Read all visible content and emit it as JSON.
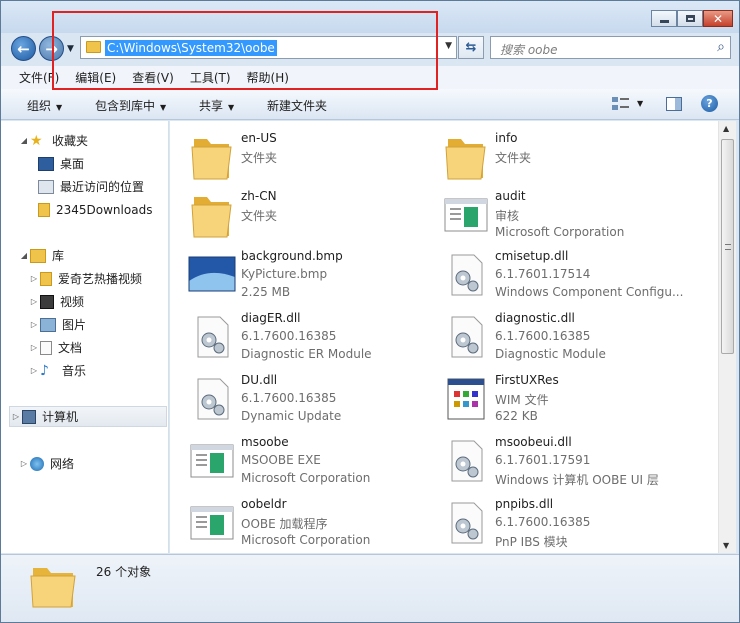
{
  "address": {
    "path": "C:\\Windows\\System32\\oobe"
  },
  "search": {
    "placeholder": "搜索 oobe"
  },
  "menu": [
    "文件(F)",
    "编辑(E)",
    "查看(V)",
    "工具(T)",
    "帮助(H)"
  ],
  "toolbar": {
    "organize": "组织",
    "include": "包含到库中",
    "share": "共享",
    "new_folder": "新建文件夹"
  },
  "nav": {
    "favorites": "收藏夹",
    "desktop": "桌面",
    "recent": "最近访问的位置",
    "downloads": "2345Downloads",
    "libraries": "库",
    "iqiyi": "爱奇艺热播视频",
    "videos": "视频",
    "pictures": "图片",
    "documents": "文档",
    "music": "音乐",
    "computer": "计算机",
    "network": "网络"
  },
  "files": [
    {
      "name": "en-US",
      "l2": "文件夹",
      "l3": "",
      "icon": "folder-icon"
    },
    {
      "name": "info",
      "l2": "文件夹",
      "l3": "",
      "icon": "folder-icon"
    },
    {
      "name": "zh-CN",
      "l2": "文件夹",
      "l3": "",
      "icon": "folder-icon"
    },
    {
      "name": "audit",
      "l2": "审核",
      "l3": "Microsoft Corporation",
      "icon": "exe-icon"
    },
    {
      "name": "background.bmp",
      "l2": "KyPicture.bmp",
      "l3": "2.25 MB",
      "icon": "image-icon"
    },
    {
      "name": "cmisetup.dll",
      "l2": "6.1.7601.17514",
      "l3": "Windows Component Configu...",
      "icon": "dll-icon"
    },
    {
      "name": "diagER.dll",
      "l2": "6.1.7600.16385",
      "l3": "Diagnostic ER Module",
      "icon": "dll-icon"
    },
    {
      "name": "diagnostic.dll",
      "l2": "6.1.7600.16385",
      "l3": "Diagnostic Module",
      "icon": "dll-icon"
    },
    {
      "name": "DU.dll",
      "l2": "6.1.7600.16385",
      "l3": "Dynamic Update",
      "icon": "dll-icon"
    },
    {
      "name": "FirstUXRes",
      "l2": "WIM 文件",
      "l3": "622 KB",
      "icon": "wim-icon"
    },
    {
      "name": "msoobe",
      "l2": "MSOOBE EXE",
      "l3": "Microsoft Corporation",
      "icon": "exe-icon"
    },
    {
      "name": "msoobeui.dll",
      "l2": "6.1.7601.17591",
      "l3": "Windows 计算机 OOBE UI 层",
      "icon": "dll-icon"
    },
    {
      "name": "oobeldr",
      "l2": "OOBE 加载程序",
      "l3": "Microsoft Corporation",
      "icon": "exe-icon"
    },
    {
      "name": "pnpibs.dll",
      "l2": "6.1.7600.16385",
      "l3": "PnP IBS 模块",
      "icon": "dll-icon"
    }
  ],
  "status": {
    "count": "26 个对象"
  }
}
